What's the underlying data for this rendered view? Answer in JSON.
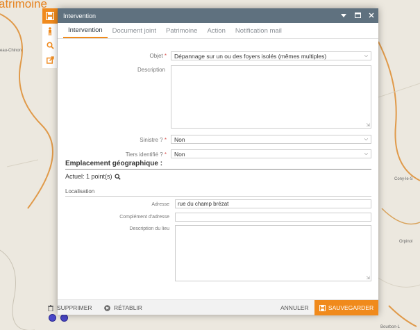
{
  "map": {
    "title": "atrimoine",
    "labels": [
      "eau-Chinon",
      "Cony-le-S",
      "Orpinol",
      "Bourbon-L"
    ]
  },
  "window": {
    "title": "Intervention",
    "controls": [
      "chevron-down-icon",
      "restore-icon",
      "close-icon"
    ]
  },
  "tabs": [
    "Intervention",
    "Document joint",
    "Patrimoine",
    "Action",
    "Notification mail"
  ],
  "form": {
    "objet_label": "Objet",
    "objet_value": "Dépannage sur un ou des foyers isolés (mêmes multiples)",
    "description_label": "Description",
    "sinistre_label": "Sinistre ?",
    "sinistre_value": "Non",
    "tiers_label": "Tiers identifié ?",
    "tiers_value": "Non",
    "required_mark": "*"
  },
  "geo": {
    "heading": "Emplacement géographique :",
    "actuel": "Actuel: 1 point(s)",
    "localisation": "Localisation",
    "adresse_label": "Adresse",
    "adresse_value": "rue du champ brézat",
    "complement_label": "Complément d'adresse",
    "complement_value": "",
    "desc_lieu_label": "Description du lieu"
  },
  "footer": {
    "delete": "SUPPRIMER",
    "restore": "RÉTABLIR",
    "cancel": "ANNULER",
    "save": "SAUVEGARDER"
  },
  "colors": {
    "accent": "#f08a1c",
    "titlebar": "#5f717f"
  }
}
